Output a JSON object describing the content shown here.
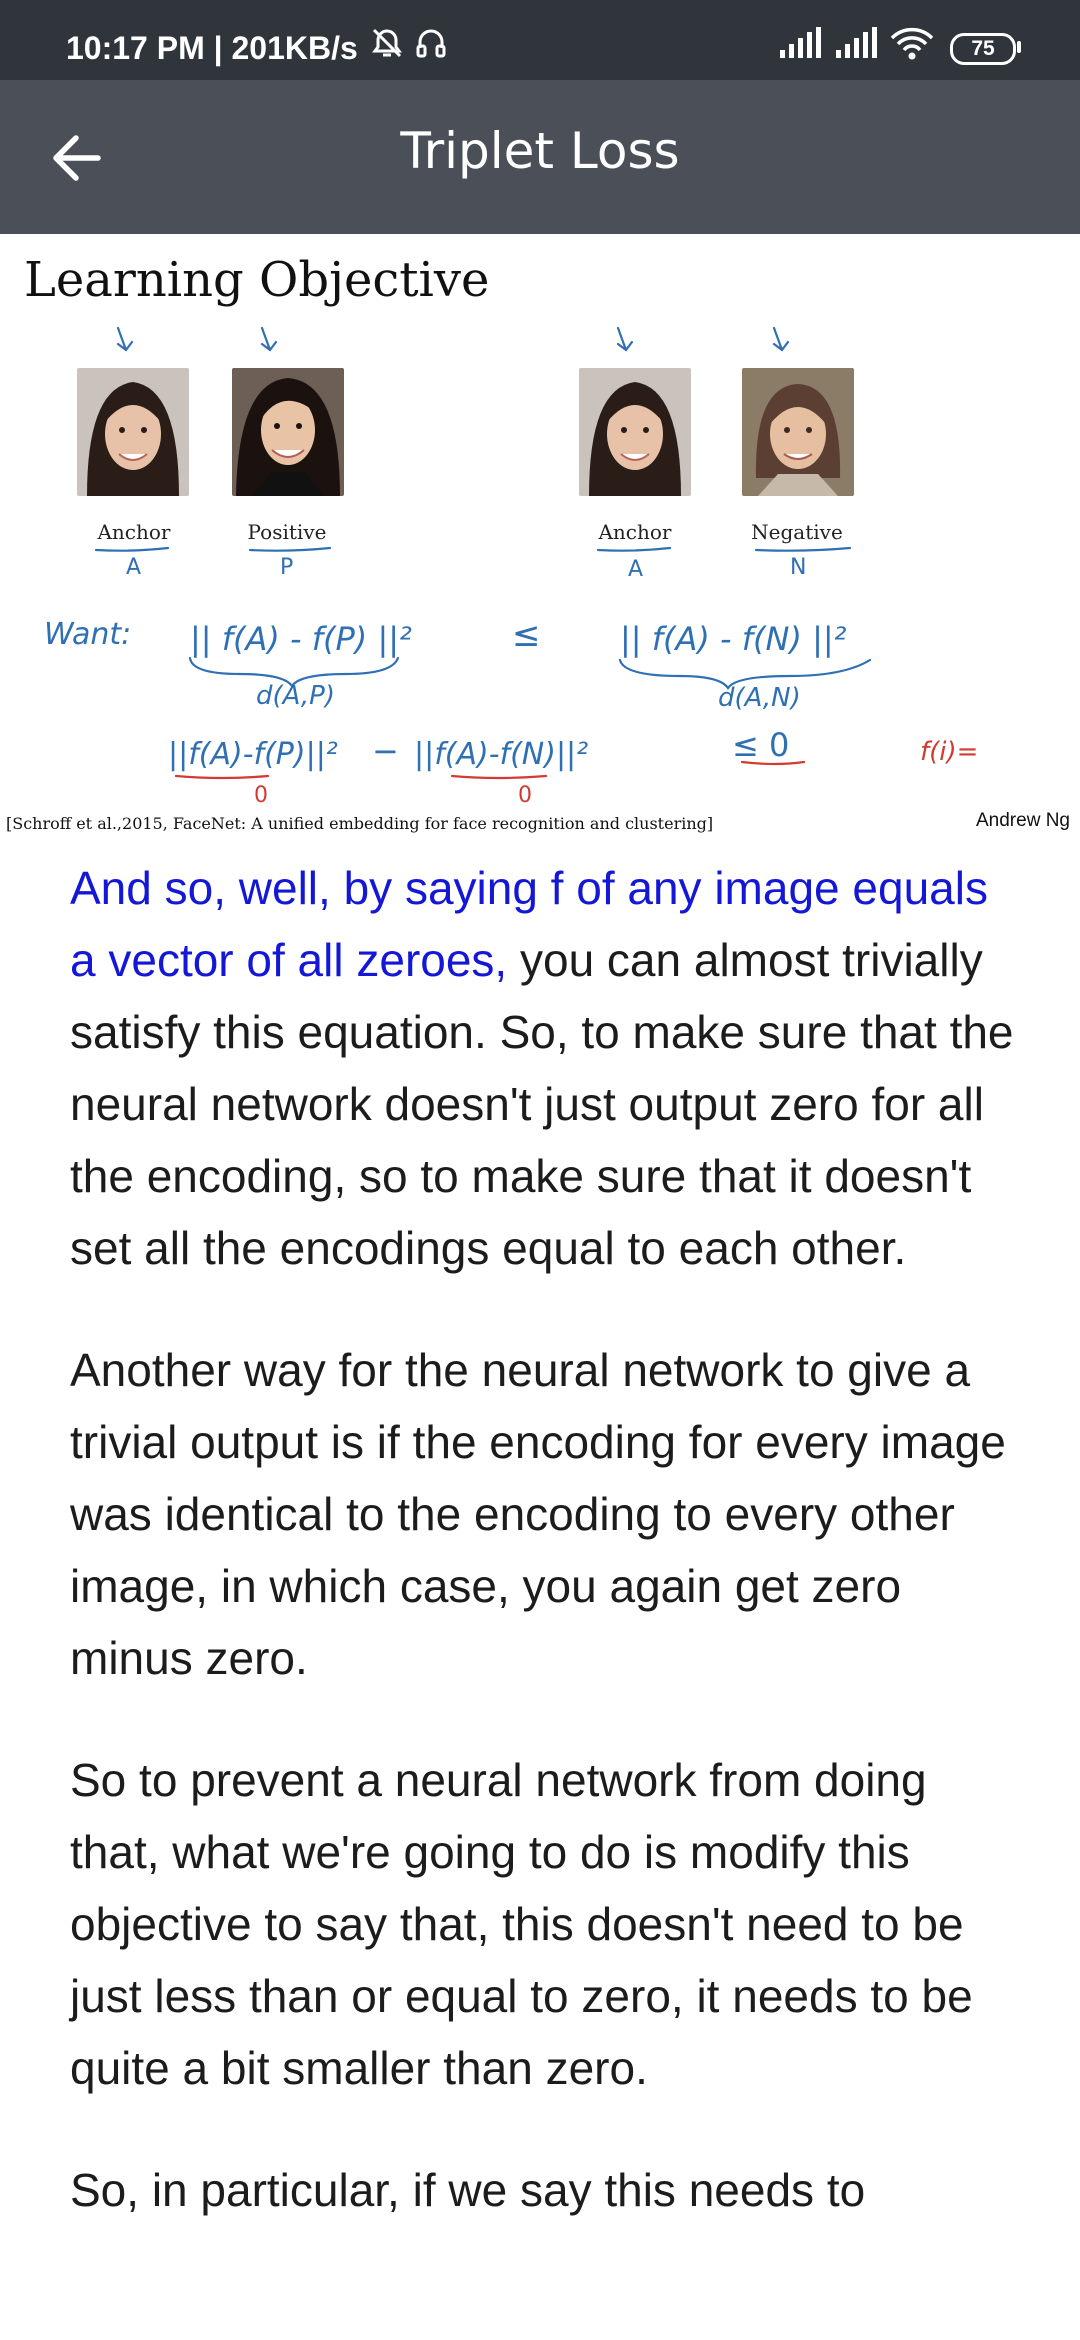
{
  "status_bar": {
    "time_speed": "10:17 PM | 201KB/s",
    "icons": [
      "alarm-off-icon",
      "headset-icon",
      "signal-icon",
      "signal-icon",
      "wifi-icon"
    ],
    "battery": "75"
  },
  "app_bar": {
    "title": "Triplet Loss",
    "back_icon": "arrow-left-icon"
  },
  "slide": {
    "title": "Learning Objective",
    "labels": {
      "anchor": "Anchor",
      "positive": "Positive",
      "negative": "Negative"
    },
    "handwriting": {
      "a1": "A",
      "p": "P",
      "a2": "A",
      "n": "N",
      "want": "Want:",
      "lhs": "|| f(A) - f(P) ||²",
      "leq": "≤",
      "rhs": "|| f(A) - f(N) ||²",
      "d_ap": "d(A,P)",
      "d_an": "d(A,N)",
      "eq2_left": "||f(A)-f(P)||²",
      "minus": "−",
      "eq2_right": "||f(A)-f(N)||²",
      "leq_zero": "≤ 0",
      "zero1": "0",
      "zero2": "0",
      "red_note": "f(i)="
    },
    "citation": "[Schroff et al.,2015, FaceNet: A unified embedding for face recognition and clustering]",
    "author": "Andrew Ng"
  },
  "transcript": {
    "p1_highlight": "And so, well, by saying f of any image equals a vector of all zeroes,",
    "p1_rest": " you can almost trivially satisfy this equation. So, to make sure that the neural network doesn't just output zero for all the encoding, so to make sure that it doesn't set all the encodings equal to each other.",
    "p2": "Another way for the neural network to give a trivial output is if the encoding for every image was identical to the encoding to every other image, in which case, you again get zero minus zero.",
    "p3": "So to prevent a neural network from doing that, what we're going to do is modify this objective to say that, this doesn't need to be just less than or equal to zero, it needs to be quite a bit smaller than zero.",
    "p4": "So, in particular, if we say this needs to"
  },
  "colors": {
    "status_bar": "#30343b",
    "app_bar": "#4b5058",
    "highlight_text": "#1418d6",
    "ink_blue": "#2f6fb3",
    "ink_red": "#d23a32"
  }
}
